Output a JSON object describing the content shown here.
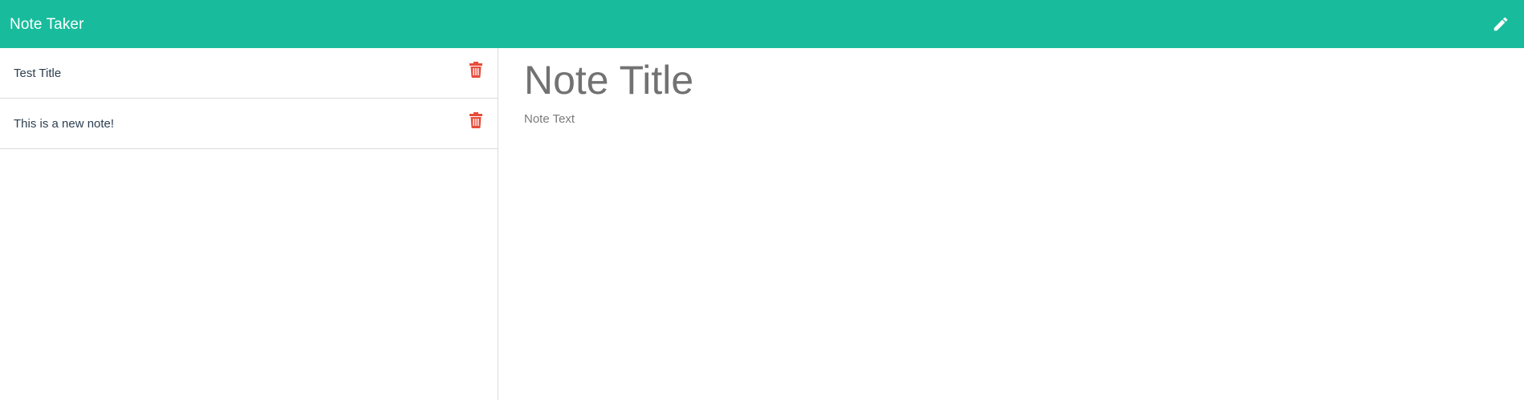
{
  "app": {
    "title": "Note Taker"
  },
  "colors": {
    "navbar": "#18bc9c",
    "delete_icon": "#e74c3c",
    "pencil_icon": "#ffffff"
  },
  "toolbar": {
    "new_note_icon": "pencil-icon"
  },
  "notes": [
    {
      "title": "Test Title",
      "delete_icon": "trash-icon"
    },
    {
      "title": "This is a new note!",
      "delete_icon": "trash-icon"
    }
  ],
  "editor": {
    "title_placeholder": "Note Title",
    "text_placeholder": "Note Text",
    "title_value": "",
    "text_value": ""
  }
}
